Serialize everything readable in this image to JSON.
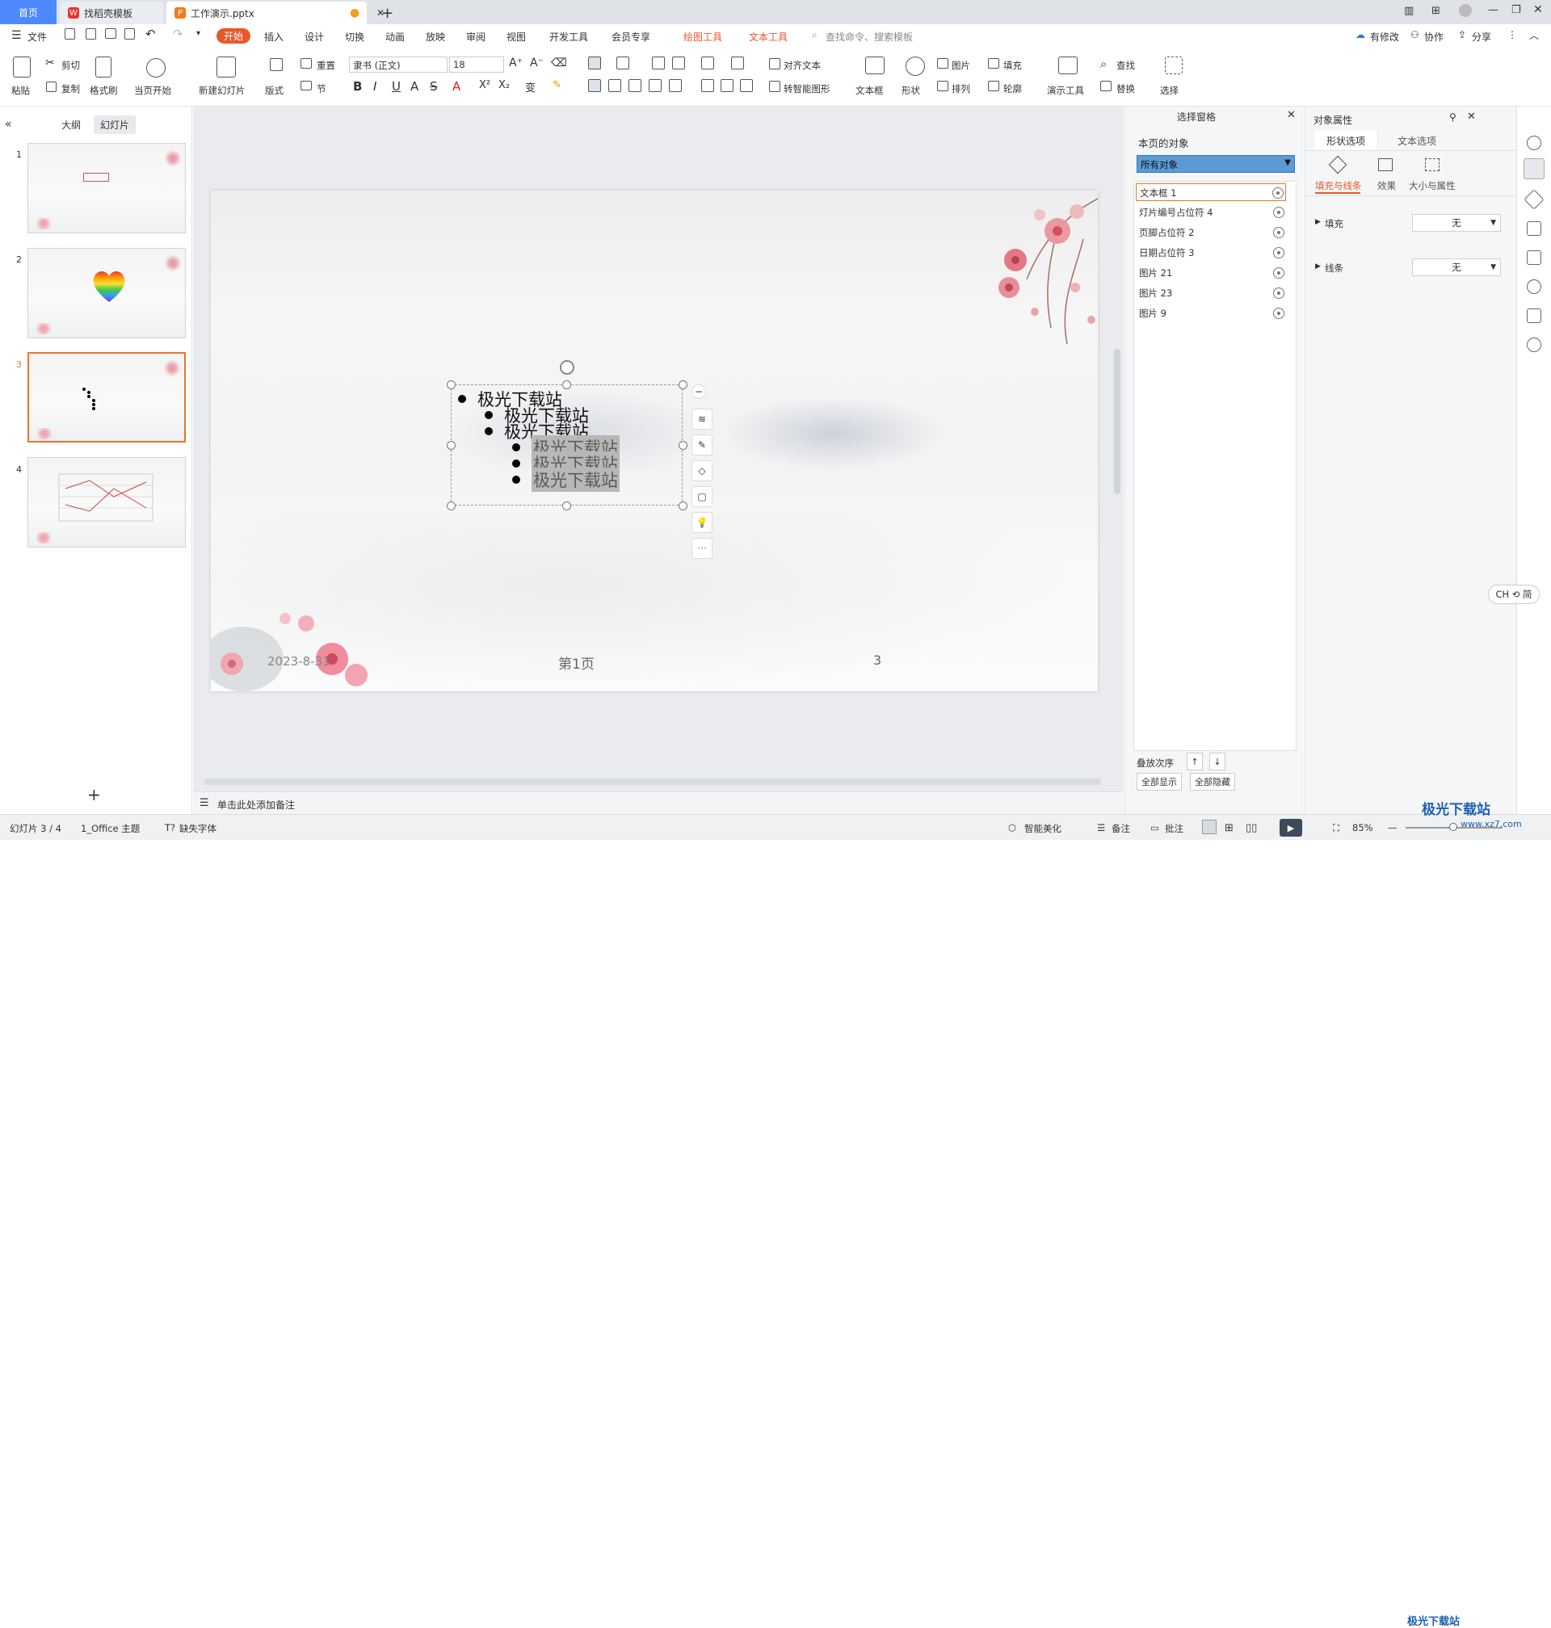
{
  "tabs": {
    "home": "首页",
    "find_template": "找稻壳模板",
    "doc": "工作演示.pptx"
  },
  "menu": {
    "file": "文件",
    "items": [
      "开始",
      "插入",
      "设计",
      "切换",
      "动画",
      "放映",
      "审阅",
      "视图",
      "开发工具",
      "会员专享"
    ],
    "draw_tool": "绘图工具",
    "text_tool": "文本工具",
    "search_placeholder": "查找命令、搜索模板",
    "has_changes": "有修改",
    "collab": "协作",
    "share": "分享"
  },
  "ribbon": {
    "paste": "粘贴",
    "cut": "剪切",
    "copy": "复制",
    "format_painter": "格式刷",
    "from_current": "当页开始",
    "new_slide": "新建幻灯片",
    "layout": "版式",
    "reset": "重置",
    "section": "节",
    "font": "隶书 (正文)",
    "size": "18",
    "align_text": "对齐文本",
    "smart_graphic": "转智能图形",
    "textbox": "文本框",
    "shape": "形状",
    "picture": "图片",
    "fill": "填充",
    "arrange": "排列",
    "outline": "轮廓",
    "present_tool": "演示工具",
    "find": "查找",
    "replace": "替换",
    "select": "选择"
  },
  "left": {
    "outline_tab": "大纲",
    "slides_tab": "幻灯片",
    "slide_nums": [
      "1",
      "2",
      "3",
      "4"
    ]
  },
  "slide": {
    "bullets": [
      "极光下载站",
      "极光下载站",
      "极光下载站",
      "极光下载站",
      "极光下载站",
      "极光下载站"
    ],
    "date": "2023-8-31",
    "footer": "第1页",
    "page_num": "3"
  },
  "notes_placeholder": "单击此处添加备注",
  "selection_pane": {
    "title": "选择窗格",
    "subtitle": "本页的对象",
    "filter": "所有对象",
    "objects": [
      "文本框 1",
      "灯片编号占位符 4",
      "页脚占位符 2",
      "日期占位符 3",
      "图片 21",
      "图片 23",
      "图片 9"
    ],
    "order_label": "叠放次序",
    "show_all": "全部显示",
    "hide_all": "全部隐藏"
  },
  "object_props": {
    "title": "对象属性",
    "tab_shape": "形状选项",
    "tab_text": "文本选项",
    "sub_fill_line": "填充与线条",
    "sub_effect": "效果",
    "sub_size": "大小与属性",
    "fill_label": "填充",
    "fill_value": "无",
    "line_label": "线条",
    "line_value": "无"
  },
  "ime": "CH ⟲ 简",
  "status": {
    "slide_info": "幻灯片 3 / 4",
    "theme": "1_Office 主题",
    "missing_font": "缺失字体",
    "smart_beautify": "智能美化",
    "notes": "备注",
    "comments": "批注",
    "zoom": "85%"
  },
  "watermark": {
    "text": "极光下载站",
    "url": "www.xz7.com"
  }
}
